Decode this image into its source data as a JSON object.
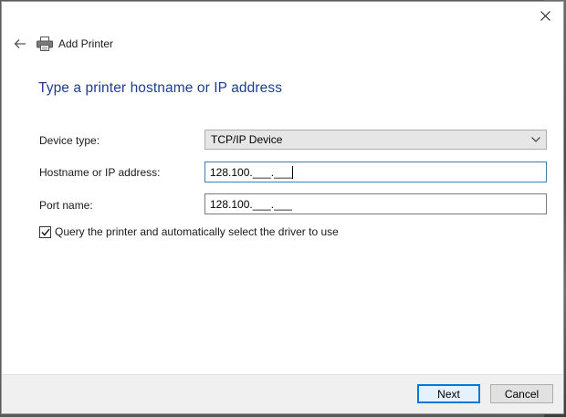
{
  "window": {
    "header_title": "Add Printer",
    "icons": {
      "back": "back-arrow-icon",
      "printer": "printer-icon",
      "close": "close-icon"
    }
  },
  "page": {
    "title": "Type a printer hostname or IP address"
  },
  "form": {
    "device_type": {
      "label": "Device type:",
      "value": "TCP/IP Device"
    },
    "hostname": {
      "label": "Hostname or IP address:",
      "value": "128.100.___.___"
    },
    "port_name": {
      "label": "Port name:",
      "value": "128.100.___.___"
    },
    "query_driver": {
      "label": "Query the printer and automatically select the driver to use",
      "checked": true
    }
  },
  "footer": {
    "next_label": "Next",
    "cancel_label": "Cancel"
  },
  "colors": {
    "title_blue": "#1f3f8a",
    "focus_border": "#3c7fb1",
    "default_button_border": "#0078d7"
  }
}
